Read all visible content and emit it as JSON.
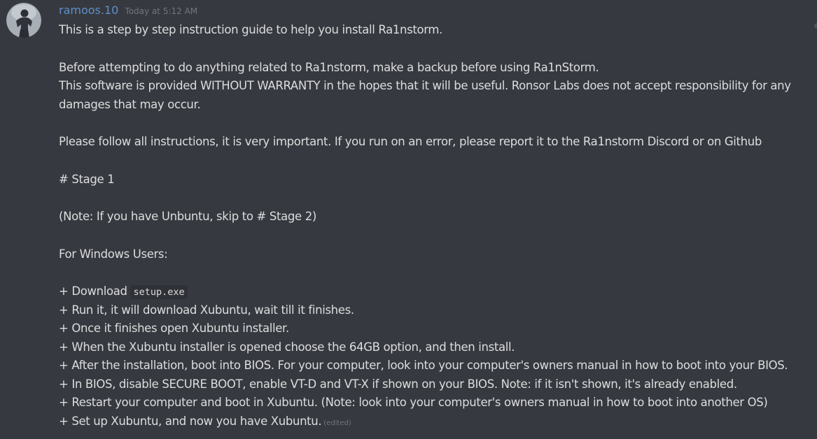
{
  "message": {
    "author": "ramoos.10",
    "timestamp": "Today at 5:12 AM",
    "avatar_icon": "user-avatar-icon",
    "edited_label": "(edited)",
    "lines": {
      "l1": "This is a step by step instruction guide to help you install Ra1nstorm.",
      "l2": "Before attempting to do anything related to Ra1nstorm, make a backup before using Ra1nStorm.",
      "l3": "This software is provided WITHOUT WARRANTY in the hopes that it will be useful. Ronsor Labs does not accept responsibility for any damages that may occur.",
      "l4": "Please follow all instructions, it is very important. If you run on an error, please report it to the Ra1nstorm Discord or on Github",
      "l5": "# Stage 1",
      "l6": "(Note: If you have Unbuntu, skip to # Stage 2)",
      "l7": "For Windows Users:",
      "l8_prefix": "+ Download ",
      "l8_code": "setup.exe",
      "l9": "+ Run it, it will download Xubuntu, wait till it finishes.",
      "l10": "+ Once it finishes open Xubuntu installer.",
      "l11": "+ When the Xubuntu installer is opened choose the 64GB option, and then install.",
      "l12": "+ After the installation, boot into BIOS. For your computer, look into your computer's owners manual in how to boot into your BIOS.",
      "l13": "+ In BIOS, disable SECURE BOOT, enable VT-D and VT-X if shown on your BIOS. Note: if it isn't shown, it's already enabled.",
      "l14": "+ Restart your computer and boot in Xubuntu. (Note: look into your computer's owners manual in how to boot into another OS)",
      "l15": "+ Set up Xubuntu, and now you have Xubuntu."
    }
  },
  "colors": {
    "background": "#36393f",
    "username": "#5f8fc9",
    "text": "#dcddde",
    "muted": "#72767d"
  }
}
